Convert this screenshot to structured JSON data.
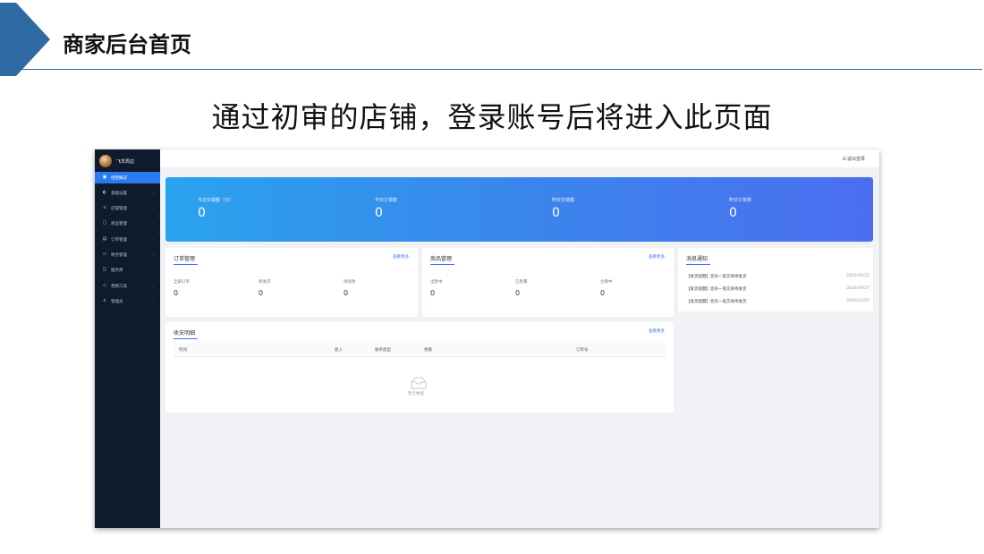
{
  "slide": {
    "title": "商家后台首页",
    "subtitle": "通过初审的店铺，登录账号后将进入此页面"
  },
  "colors": {
    "accent": "#2b7bf0",
    "sidebar": "#0f1a2c",
    "banner_start": "#2aa3ee",
    "banner_end": "#4b6ef0",
    "slide_arrow": "#2f6aa5"
  },
  "app": {
    "user_name": "飞羊周边",
    "logout_label": "退出登录",
    "logout_icon": "logout-icon",
    "sidebar": {
      "items": [
        {
          "label": "经营概况",
          "icon": "dashboard-icon",
          "active": true
        },
        {
          "label": "基础设置",
          "icon": "settings-icon"
        },
        {
          "label": "店铺管理",
          "icon": "store-icon"
        },
        {
          "label": "商品管理",
          "icon": "goods-icon"
        },
        {
          "label": "订单管理",
          "icon": "order-icon"
        },
        {
          "label": "财务管理",
          "icon": "finance-icon"
        },
        {
          "label": "服务库",
          "icon": "service-icon"
        },
        {
          "label": "营销工具",
          "icon": "marketing-icon"
        },
        {
          "label": "管理员",
          "icon": "admin-icon"
        }
      ]
    },
    "stats": [
      {
        "label": "今日交易额（元）",
        "value": "0"
      },
      {
        "label": "今日订单数",
        "value": "0"
      },
      {
        "label": "昨日交易额",
        "value": "0"
      },
      {
        "label": "昨日订单数",
        "value": "0"
      }
    ],
    "orders": {
      "title": "订单管理",
      "more": "查看更多",
      "metrics": [
        {
          "label": "全部订单",
          "value": "0"
        },
        {
          "label": "待发货",
          "value": "0"
        },
        {
          "label": "待退款",
          "value": "0"
        }
      ]
    },
    "goods": {
      "title": "商品管理",
      "more": "查看更多",
      "metrics": [
        {
          "label": "出售中",
          "value": "0"
        },
        {
          "label": "已售罄",
          "value": "0"
        },
        {
          "label": "仓库中",
          "value": "0"
        }
      ]
    },
    "messages": {
      "title": "消息通知",
      "items": [
        {
          "text": "【发货提醒】您有一笔交易待发货",
          "date": "2021/02/22"
        },
        {
          "text": "【发货提醒】您有一笔交易待发货",
          "date": "2020/09/27"
        },
        {
          "text": "【发货提醒】您有一笔交易待发货",
          "date": "2020/11/07"
        }
      ]
    },
    "ledger": {
      "title": "收支明细",
      "more": "查看更多",
      "columns": [
        "时间",
        "收入",
        "账单类型",
        "余额",
        "订单号"
      ],
      "empty_text": "暂无数据"
    }
  }
}
